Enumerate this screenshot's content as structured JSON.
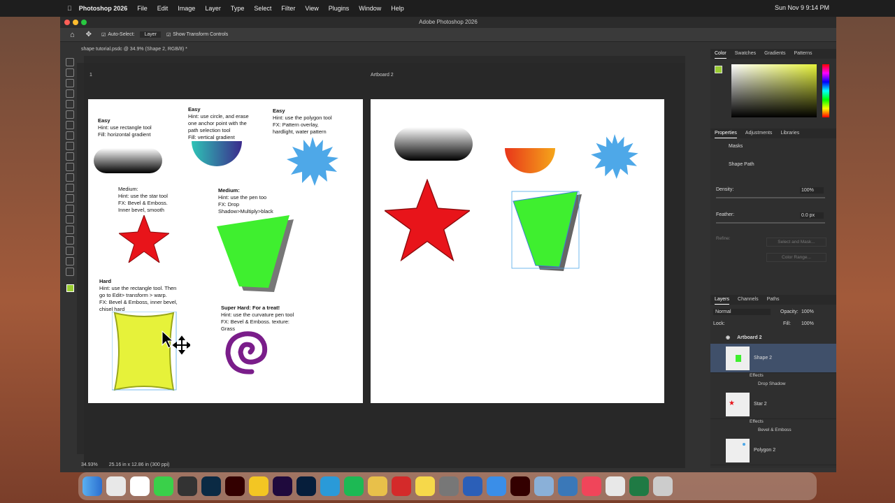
{
  "menubar": {
    "app": "Photoshop 2026",
    "items": [
      "File",
      "Edit",
      "Image",
      "Layer",
      "Type",
      "Select",
      "Filter",
      "View",
      "Plugins",
      "Window",
      "Help"
    ],
    "clock": "Sun Nov 9  9:14 PM"
  },
  "window": {
    "title": "Adobe Photoshop 2026"
  },
  "options": {
    "auto_select": "Auto-Select:",
    "layer": "Layer",
    "transform": "Show Transform Controls"
  },
  "doc_tab": "shape tutorial.psdc @ 34.9% (Shape 2, RGB/8) *",
  "artboards": {
    "ab1": "1",
    "ab2": "Artboard 2"
  },
  "hints": {
    "easy1": [
      "Easy",
      "Hint: use rectangle tool",
      "Fill: horizontal gradient"
    ],
    "easy2": [
      "Easy",
      "Hint: use circle, and erase",
      "one anchor point with the",
      "path selection tool",
      "Fill: vertical gradient"
    ],
    "easy3": [
      "Easy",
      "Hint: use the polygon tool",
      "FX: Pattern overlay,",
      "hardlight, water pattern"
    ],
    "med1": [
      "Medium:",
      "Hint: use the star tool",
      "FX: Bevel & Emboss.",
      "Inner bevel, smooth"
    ],
    "med2": [
      "Medium:",
      "Hint: use the pen too",
      "FX: Drop",
      "Shadow>Multiply>black"
    ],
    "hard": [
      "Hard",
      "Hint: use the rectangle tool. Then",
      "go to Edit> transform > warp.",
      "FX: Bevel & Emboss, inner bevel,",
      "chisel hard"
    ],
    "super": [
      "Super Hard: For a treat!",
      "Hint: use the curvature pen tool",
      "FX: Bevel & Emboss. texture:",
      "Grass"
    ]
  },
  "panels": {
    "color_tabs": [
      "Color",
      "Swatches",
      "Gradients",
      "Patterns"
    ],
    "props_tabs": [
      "Properties",
      "Adjustments",
      "Libraries"
    ],
    "masks": "Masks",
    "shape_path": "Shape Path",
    "density_label": "Density:",
    "density": "100%",
    "feather_label": "Feather:",
    "feather": "0.0 px",
    "refine": "Refine:",
    "select_mask": "Select and Mask...",
    "color_range": "Color Range...",
    "layers_tabs": [
      "Layers",
      "Channels",
      "Paths"
    ],
    "blend": "Normal",
    "opacity_label": "Opacity:",
    "opacity": "100%",
    "lock_label": "Lock:",
    "fill_label": "Fill:",
    "fill": "100%",
    "artboard_group": "Artboard 2",
    "layers": [
      {
        "name": "Shape 2",
        "effects": "Effects",
        "fx": "Drop Shadow"
      },
      {
        "name": "Star 2",
        "effects": "Effects",
        "fx": "Bevel & Emboss"
      },
      {
        "name": "Polygon 2"
      }
    ]
  },
  "status": {
    "zoom": "34.93%",
    "size": "25.16 in x 12.86 in (300 ppi)"
  },
  "colors": {
    "fg": "#9acd32",
    "green": "#3fef2f",
    "red": "#e8141a",
    "yellow": "#e6f23a",
    "blue": "#4ea8e8",
    "purple": "#7a1d8a"
  }
}
